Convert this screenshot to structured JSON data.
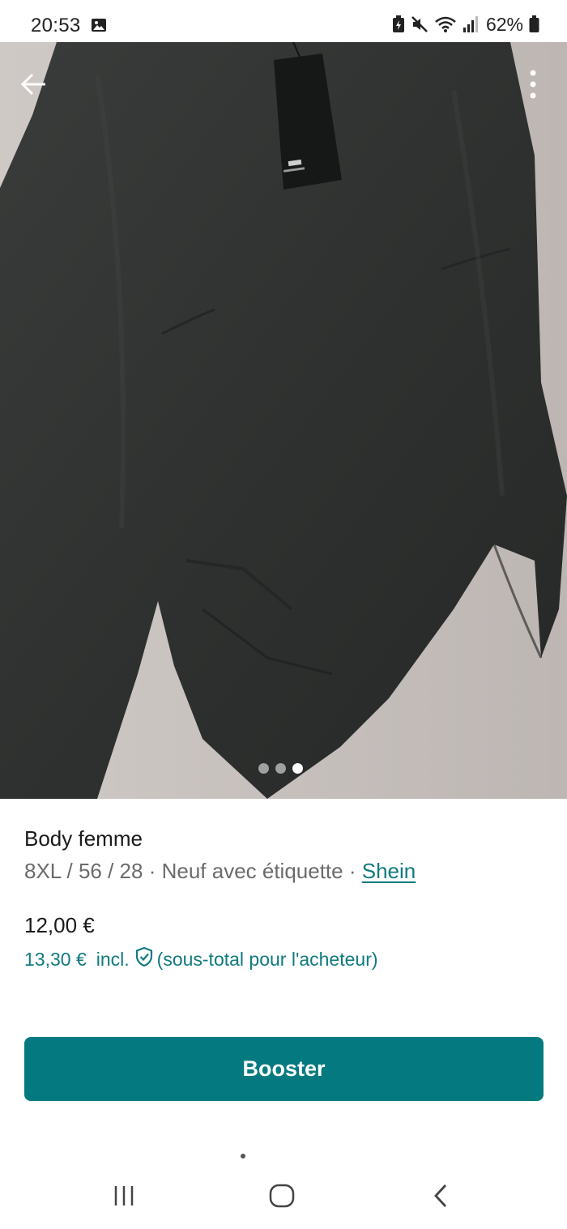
{
  "status_bar": {
    "time": "20:53",
    "battery_percent": "62%",
    "icons": [
      "gallery-icon",
      "battery-saver-icon",
      "mute-icon",
      "wifi-icon",
      "signal-icon",
      "battery-icon"
    ]
  },
  "header": {
    "back_icon": "arrow-left-icon",
    "menu_icon": "more-vertical-icon"
  },
  "gallery": {
    "photo_count": 3,
    "active_index": 2
  },
  "item": {
    "title": "Body femme",
    "meta_prefix": "8XL / 56 / 28 · Neuf avec étiquette · ",
    "brand": "Shein",
    "price": "12,00 €",
    "buyer_price": "13,30 €",
    "incl_label": "incl.",
    "incl_note": "(sous-total pour l'acheteur)"
  },
  "actions": {
    "booster_label": "Booster"
  },
  "colors": {
    "accent": "#047a80",
    "link": "#0f7a80",
    "meta_text": "#6b6b6b"
  },
  "nav": {
    "icons": [
      "recent-apps-icon",
      "home-icon",
      "back-icon"
    ]
  }
}
